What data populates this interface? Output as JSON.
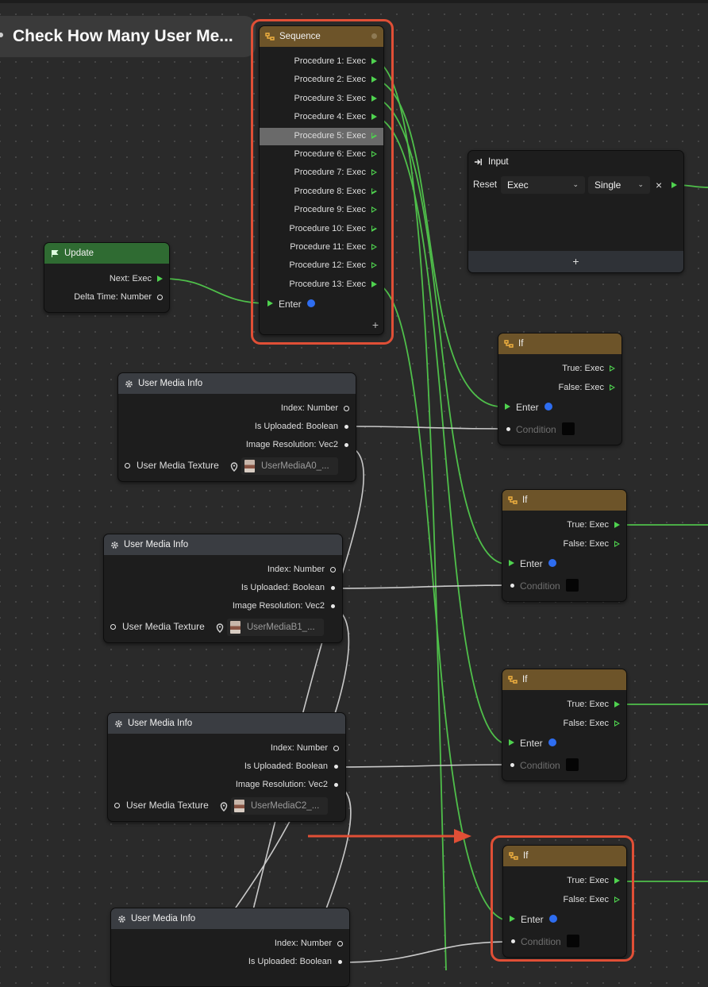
{
  "title": "Check How Many User Me...",
  "colors": {
    "exec_pin": "#4fd24f",
    "wire_exec": "#4fbf4a",
    "wire_data": "#c9c9c9",
    "highlight": "#e04f36",
    "enter_pin": "#2e6df0"
  },
  "sequence": {
    "title": "Sequence",
    "procedures": [
      "Procedure 1: Exec",
      "Procedure 2: Exec",
      "Procedure 3: Exec",
      "Procedure 4: Exec",
      "Procedure 5: Exec",
      "Procedure 6: Exec",
      "Procedure 7: Exec",
      "Procedure 8: Exec",
      "Procedure 9: Exec",
      "Procedure 10: Exec",
      "Procedure 11: Exec",
      "Procedure 12: Exec",
      "Procedure 13: Exec"
    ],
    "enter_label": "Enter",
    "add_label": "+"
  },
  "update": {
    "title": "Update",
    "next": "Next: Exec",
    "delta": "Delta Time: Number"
  },
  "input": {
    "title": "Input",
    "reset_label": "Reset",
    "type_value": "Exec",
    "mode_value": "Single",
    "remove_label": "×",
    "add_label": "+"
  },
  "if_nodes": [
    {
      "title": "If",
      "true_label": "True: Exec",
      "false_label": "False: Exec",
      "enter_label": "Enter",
      "condition_label": "Condition"
    },
    {
      "title": "If",
      "true_label": "True: Exec",
      "false_label": "False: Exec",
      "enter_label": "Enter",
      "condition_label": "Condition"
    },
    {
      "title": "If",
      "true_label": "True: Exec",
      "false_label": "False: Exec",
      "enter_label": "Enter",
      "condition_label": "Condition"
    },
    {
      "title": "If",
      "true_label": "True: Exec",
      "false_label": "False: Exec",
      "enter_label": "Enter",
      "condition_label": "Condition"
    }
  ],
  "media_nodes": [
    {
      "title": "User Media Info",
      "index": "Index: Number",
      "uploaded": "Is Uploaded: Boolean",
      "resolution": "Image Resolution: Vec2",
      "texture_label": "User Media Texture",
      "texture_value": "UserMediaA0_..."
    },
    {
      "title": "User Media Info",
      "index": "Index: Number",
      "uploaded": "Is Uploaded: Boolean",
      "resolution": "Image Resolution: Vec2",
      "texture_label": "User Media Texture",
      "texture_value": "UserMediaB1_..."
    },
    {
      "title": "User Media Info",
      "index": "Index: Number",
      "uploaded": "Is Uploaded: Boolean",
      "resolution": "Image Resolution: Vec2",
      "texture_label": "User Media Texture",
      "texture_value": "UserMediaC2_..."
    },
    {
      "title": "User Media Info",
      "index": "Index: Number",
      "uploaded": "Is Uploaded: Boolean"
    }
  ]
}
